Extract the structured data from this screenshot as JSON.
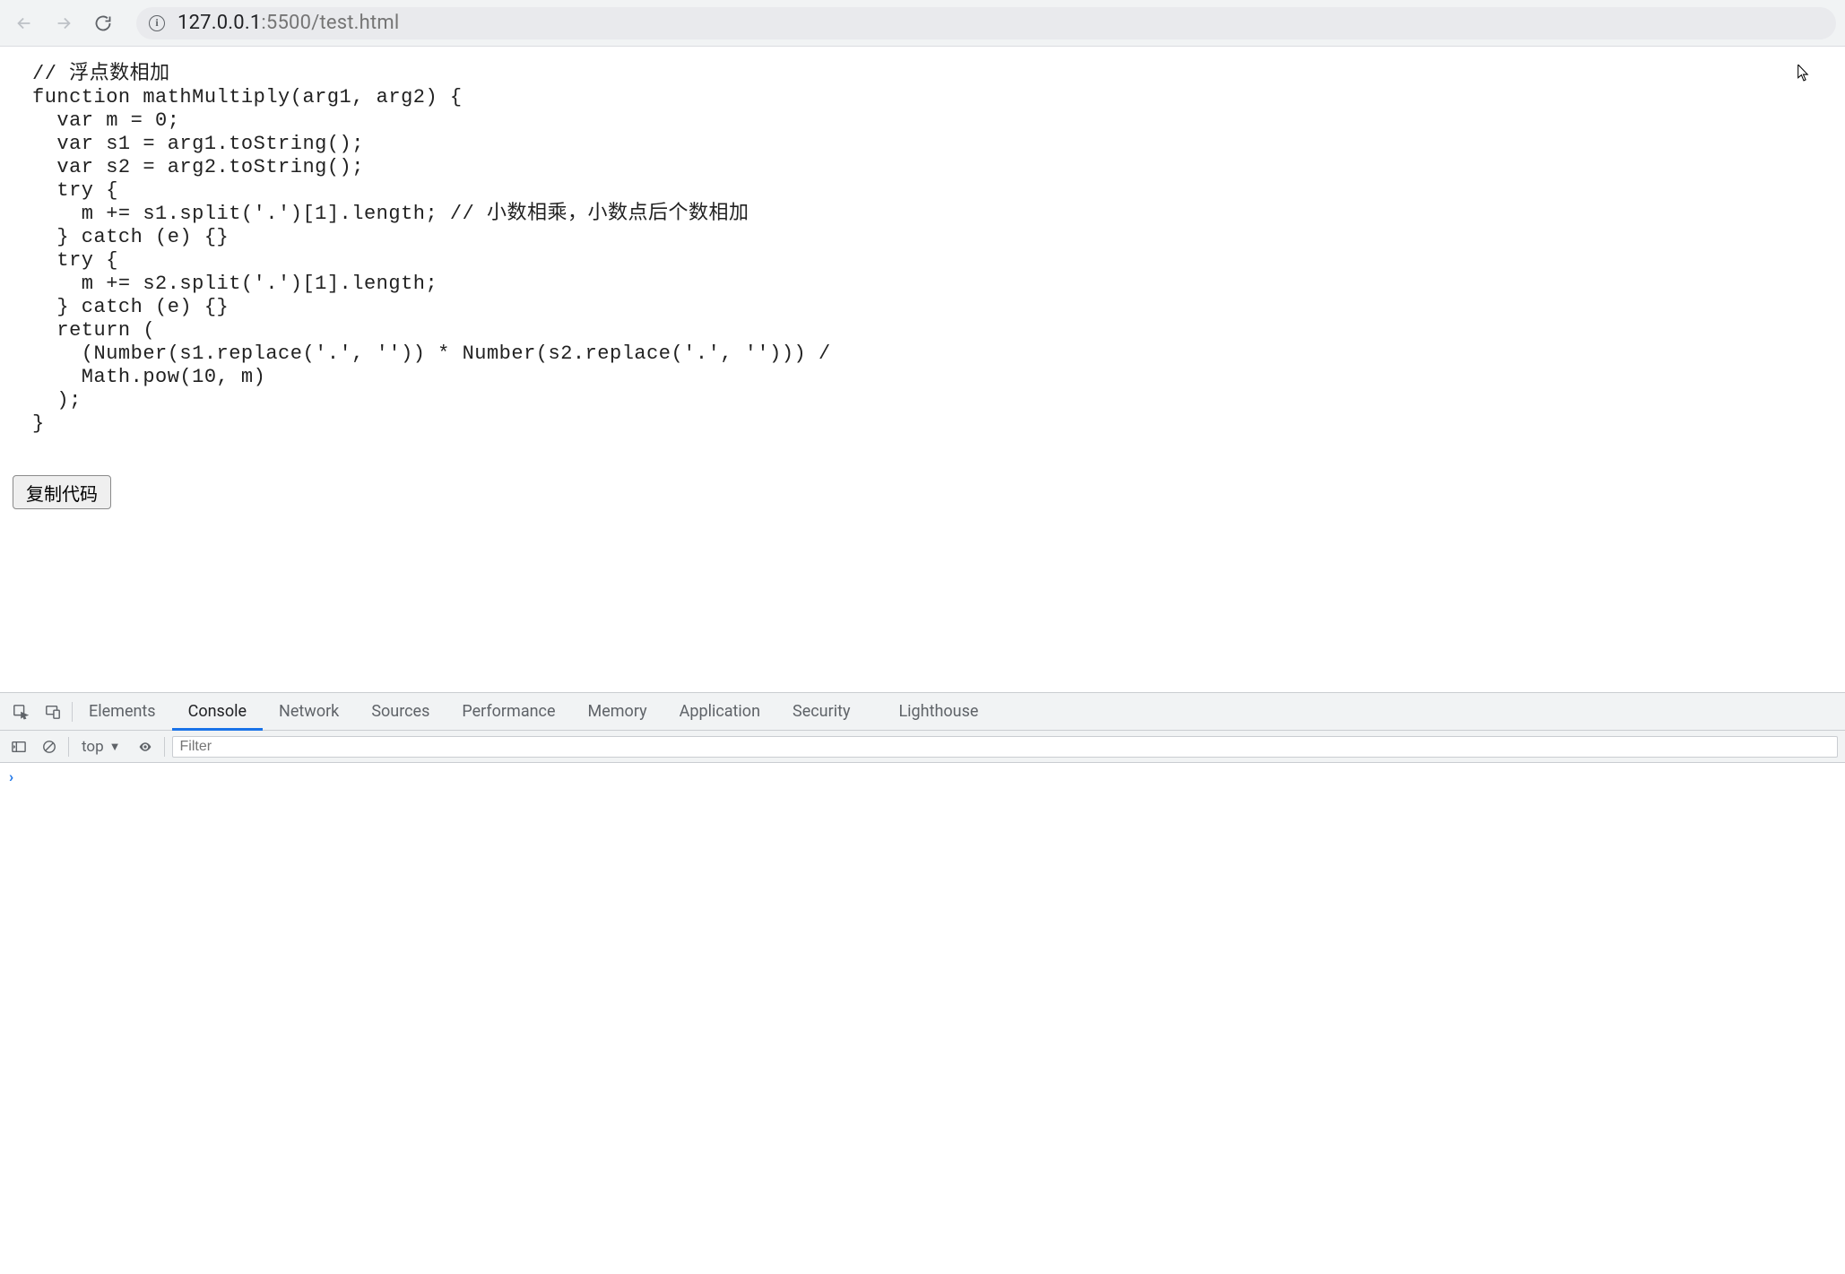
{
  "browser": {
    "url_host": "127.0.0.1",
    "url_port": ":5500",
    "url_path": "/test.html"
  },
  "page": {
    "code": "// 浮点数相加\nfunction mathMultiply(arg1, arg2) {\n  var m = 0;\n  var s1 = arg1.toString();\n  var s2 = arg2.toString();\n  try {\n    m += s1.split('.')[1].length; // 小数相乘，小数点后个数相加\n  } catch (e) {}\n  try {\n    m += s2.split('.')[1].length;\n  } catch (e) {}\n  return (\n    (Number(s1.replace('.', '')) * Number(s2.replace('.', ''))) /\n    Math.pow(10, m)\n  );\n}",
    "copy_button_label": "复制代码"
  },
  "devtools": {
    "tabs": [
      "Elements",
      "Console",
      "Network",
      "Sources",
      "Performance",
      "Memory",
      "Application",
      "Security",
      "Lighthouse"
    ],
    "active_tab": "Console",
    "console": {
      "context_label": "top",
      "filter_placeholder": "Filter",
      "prompt": "›"
    }
  }
}
